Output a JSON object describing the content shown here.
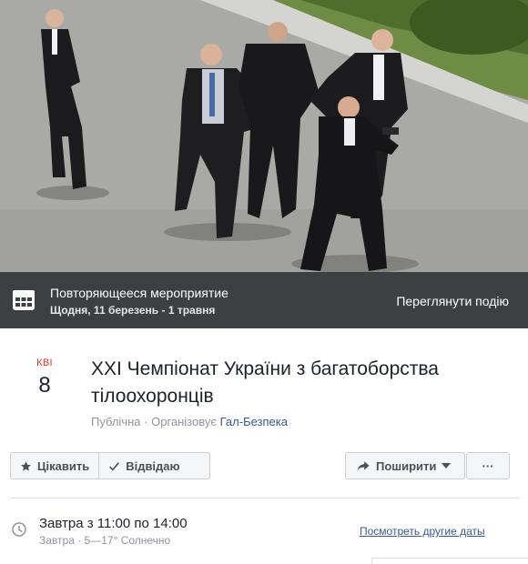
{
  "cover": {
    "photo": "men-in-black-suits-bodyguard-drill-photo"
  },
  "banner": {
    "icon": "calendar-grid-icon",
    "title": "Повторяющееся мероприятие",
    "subtitle": "Щодня, 11 березень - 1 травня",
    "view_label": "Переглянути подію"
  },
  "event": {
    "month": "КВІ",
    "day": "8",
    "title": "XXI Чемпіонат України з багатоборства тілоохоронців",
    "privacy": "Публічна",
    "separator": " · ",
    "organizer_prefix": "Організовує ",
    "organizer": "Гал-Безпека"
  },
  "actions": {
    "interested_label": "Цікавить",
    "going_label": "Відвідаю",
    "share_label": "Поширити",
    "more_label": "···"
  },
  "details": {
    "time": "Завтра з 11:00 по 14:00",
    "weather": "Завтра · 5—17° Солнечно",
    "other_dates_label": "Посмотреть другие даты"
  }
}
